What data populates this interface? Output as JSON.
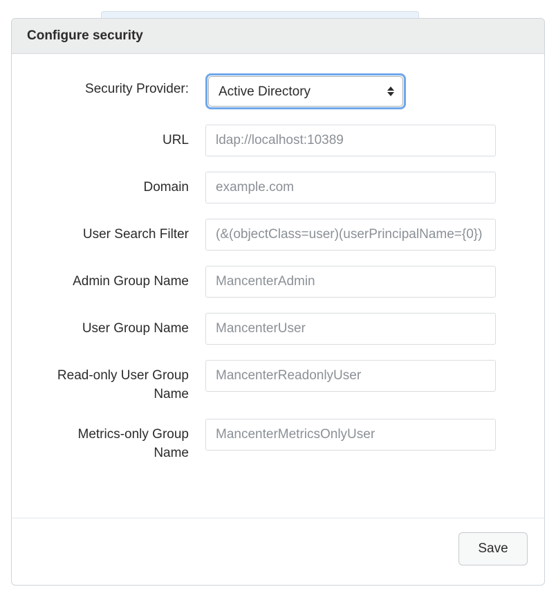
{
  "panel": {
    "title": "Configure security"
  },
  "form": {
    "provider": {
      "label": "Security Provider:",
      "value": "Active Directory"
    },
    "url": {
      "label": "URL",
      "placeholder": "ldap://localhost:10389"
    },
    "domain": {
      "label": "Domain",
      "placeholder": "example.com"
    },
    "user_search_filter": {
      "label": "User Search Filter",
      "placeholder": "(&(objectClass=user)(userPrincipalName={0})"
    },
    "admin_group_name": {
      "label": "Admin Group Name",
      "placeholder": "MancenterAdmin"
    },
    "user_group_name": {
      "label": "User Group Name",
      "placeholder": "MancenterUser"
    },
    "readonly_user_group_name": {
      "label": "Read-only User Group Name",
      "placeholder": "MancenterReadonlyUser"
    },
    "metrics_only_group_name": {
      "label": "Metrics-only Group Name",
      "placeholder": "MancenterMetricsOnlyUser"
    }
  },
  "footer": {
    "save_label": "Save"
  }
}
